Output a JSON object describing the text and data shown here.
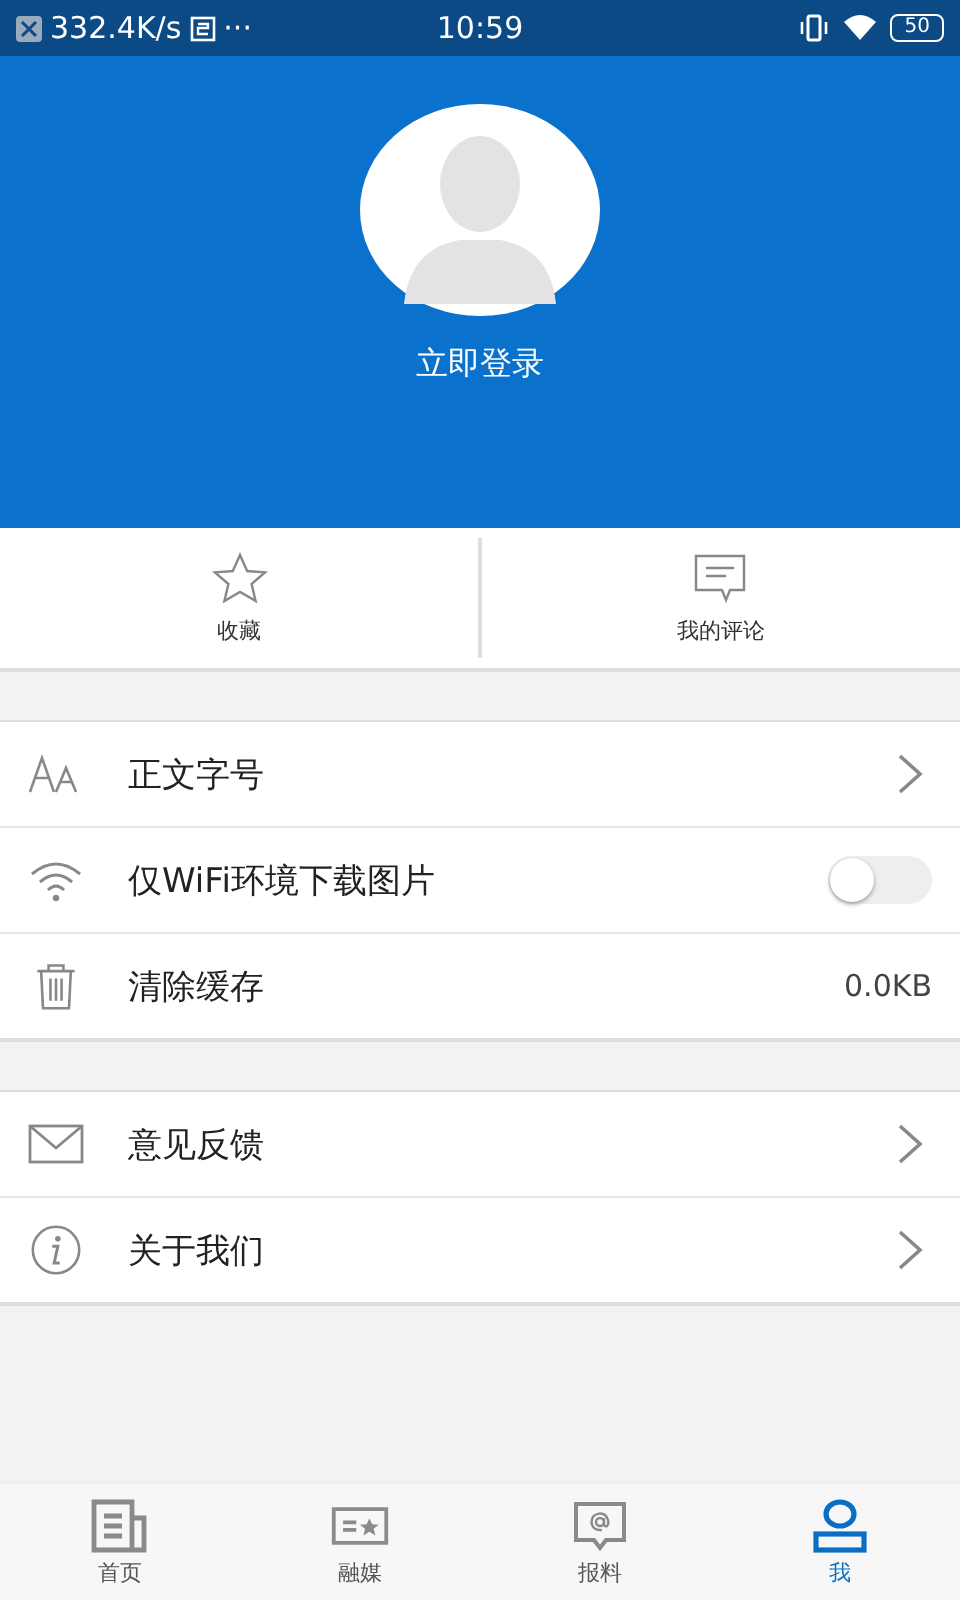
{
  "status_bar": {
    "speed": "332.4K/s",
    "more": "···",
    "time": "10:59",
    "battery": "50"
  },
  "profile": {
    "login": "立即登录"
  },
  "shortcuts": [
    {
      "kind": "star",
      "label": "收藏"
    },
    {
      "kind": "comment",
      "label": "我的评论"
    }
  ],
  "settings_groups": [
    [
      {
        "label": "正文字号",
        "kind": "chevron"
      },
      {
        "label": "仅WiFi环境下载图片",
        "kind": "toggle",
        "on": false
      },
      {
        "label": "清除缓存",
        "kind": "value",
        "value": "0.0KB"
      }
    ],
    [
      {
        "label": "意见反馈",
        "kind": "chevron"
      },
      {
        "label": "关于我们",
        "kind": "chevron"
      }
    ]
  ],
  "tab_bar": [
    {
      "label": "首页",
      "selected": false
    },
    {
      "label": "融媒",
      "selected": false
    },
    {
      "label": "报料",
      "selected": false
    },
    {
      "label": "我",
      "selected": true
    }
  ]
}
